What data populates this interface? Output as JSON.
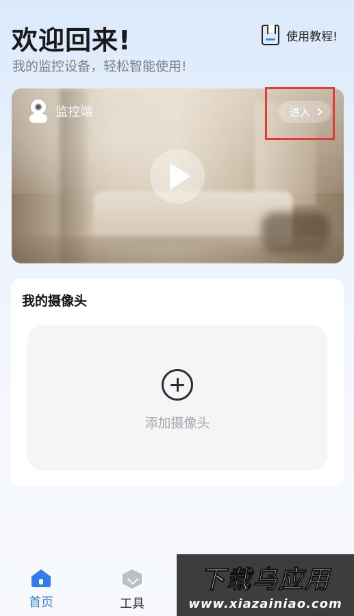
{
  "header": {
    "title": "欢迎回来!",
    "subtitle": "我的监控设备，轻松智能使用!",
    "tutorial_label": "使用教程!"
  },
  "monitor_card": {
    "label": "监控端",
    "enter_label": "进入",
    "highlight_color": "#e53935"
  },
  "cameras": {
    "title": "我的摄像头",
    "add_label": "添加摄像头"
  },
  "nav": {
    "items": [
      {
        "label": "首页",
        "icon": "home-icon",
        "active": true
      },
      {
        "label": "工具",
        "icon": "box-icon",
        "active": false
      }
    ],
    "accent_color": "#2f7ef0"
  },
  "watermark": {
    "title": "下载乌应用",
    "url": "www.xiazainiao.com"
  }
}
